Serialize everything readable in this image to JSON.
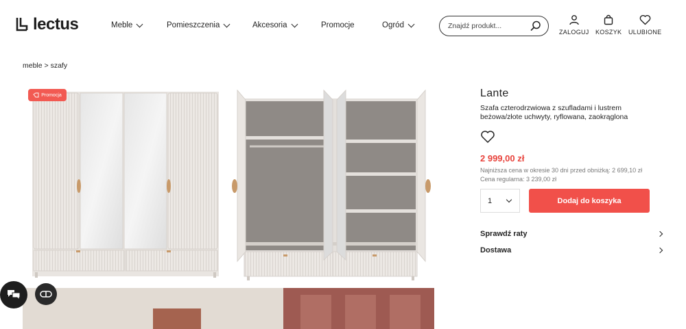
{
  "brand": {
    "name": "lectus"
  },
  "nav": {
    "items": [
      {
        "label": "Meble",
        "has_dropdown": true
      },
      {
        "label": "Pomieszczenia",
        "has_dropdown": true
      },
      {
        "label": "Akcesoria",
        "has_dropdown": true
      },
      {
        "label": "Promocje",
        "has_dropdown": false
      },
      {
        "label": "Ogród",
        "has_dropdown": true
      }
    ]
  },
  "search": {
    "placeholder": "Znajdź produkt..."
  },
  "header_actions": {
    "login": "ZALOGUJ",
    "cart": "KOSZYK",
    "favorites": "ULUBIONE"
  },
  "breadcrumb": {
    "items": [
      "meble",
      "szafy"
    ],
    "separator": ">"
  },
  "gallery": {
    "promo_badge": "Promocja"
  },
  "product": {
    "name": "Lante",
    "description": "Szafa czterodrzwiowa z szufladami i lustrem beżowa/złote uchwyty, ryflowana, zaokrąglona",
    "price": "2 999,00 zł",
    "lowest_price_note": "Najniższa cena w okresie 30 dni przed obniżką: 2 699,10 zł",
    "regular_price_note": "Cena regularna: 3 239,00 zł",
    "quantity": "1",
    "add_to_cart": "Dodaj do koszyka"
  },
  "accordions": [
    {
      "label": "Sprawdź raty"
    },
    {
      "label": "Dostawa"
    }
  ],
  "colors": {
    "accent": "#f1504a",
    "price": "#e8423b",
    "text": "#222222"
  }
}
